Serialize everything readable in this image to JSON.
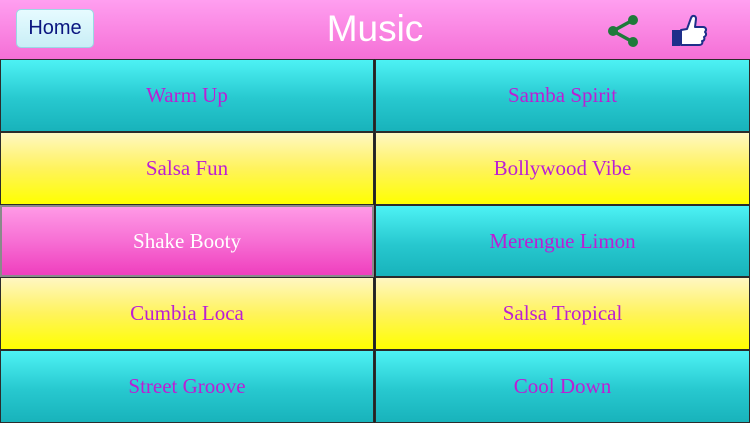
{
  "header": {
    "home_label": "Home",
    "title": "Music",
    "share_icon": "share-icon",
    "like_icon": "thumbs-up-icon"
  },
  "tracks": [
    {
      "label": "Warm Up",
      "color": "cyan"
    },
    {
      "label": "Samba Spirit",
      "color": "cyan"
    },
    {
      "label": "Salsa Fun",
      "color": "yellow"
    },
    {
      "label": "Bollywood Vibe",
      "color": "yellow"
    },
    {
      "label": "Shake Booty",
      "color": "pink"
    },
    {
      "label": "Merengue Limon",
      "color": "cyan"
    },
    {
      "label": "Cumbia Loca",
      "color": "yellow"
    },
    {
      "label": "Salsa Tropical",
      "color": "yellow"
    },
    {
      "label": "Street Groove",
      "color": "cyan"
    },
    {
      "label": "Cool Down",
      "color": "cyan"
    }
  ],
  "colors": {
    "header_pink": "#f56fd6",
    "tile_text": "#bb1fd4",
    "cyan": "#27c8cf",
    "yellow": "#ffff00",
    "pink": "#ef3fbe",
    "share_green": "#1e7a3a",
    "like_blue": "#1e2f8a"
  }
}
